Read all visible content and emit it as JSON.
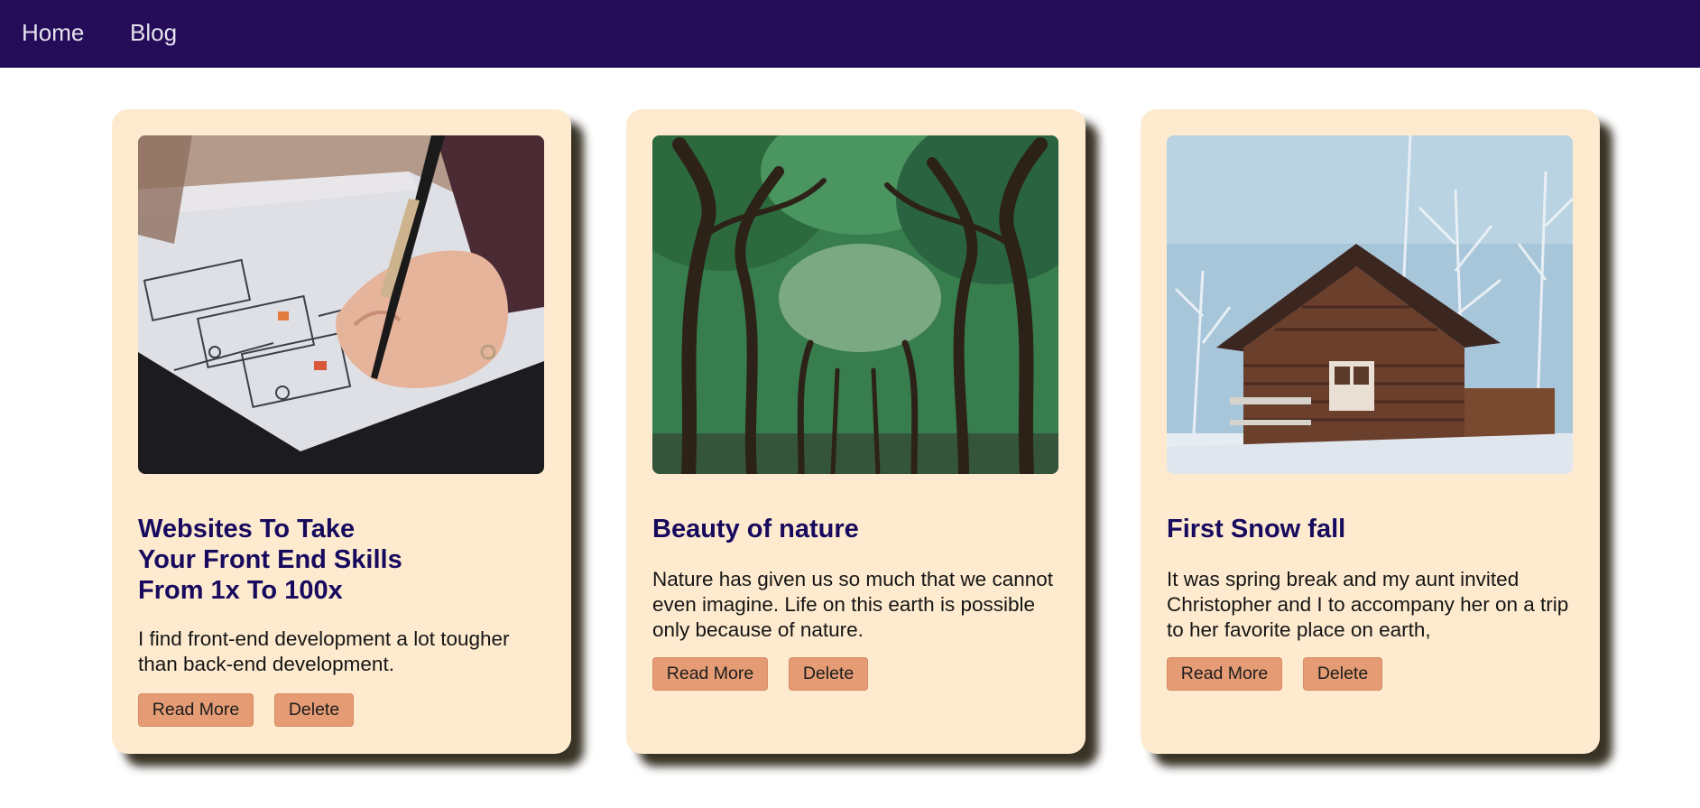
{
  "nav": {
    "links": [
      {
        "label": "Home"
      },
      {
        "label": "Blog"
      }
    ]
  },
  "colors": {
    "navbar": "#250c59",
    "card_background": "#feebcf",
    "title": "#170a5e",
    "button": "#e59c75"
  },
  "cards": [
    {
      "image": "hand-sketching-wireframe-photo",
      "title": "Websites To Take\nYour Front End Skills\nFrom 1x To 100x",
      "text": "I find front-end development a lot tougher than back-end development.",
      "read_more_label": "Read More",
      "delete_label": "Delete"
    },
    {
      "image": "tree-lined-avenue-photo",
      "title": "Beauty of nature",
      "text": "Nature has given us so much that we cannot even imagine. Life on this earth is possible only because of nature.",
      "read_more_label": "Read More",
      "delete_label": "Delete"
    },
    {
      "image": "snowy-log-cabin-photo",
      "title": "First Snow fall",
      "text": "It was spring break and my aunt invited Christopher and I to accompany her on a trip to her favorite place on earth,",
      "read_more_label": "Read More",
      "delete_label": "Delete"
    }
  ]
}
